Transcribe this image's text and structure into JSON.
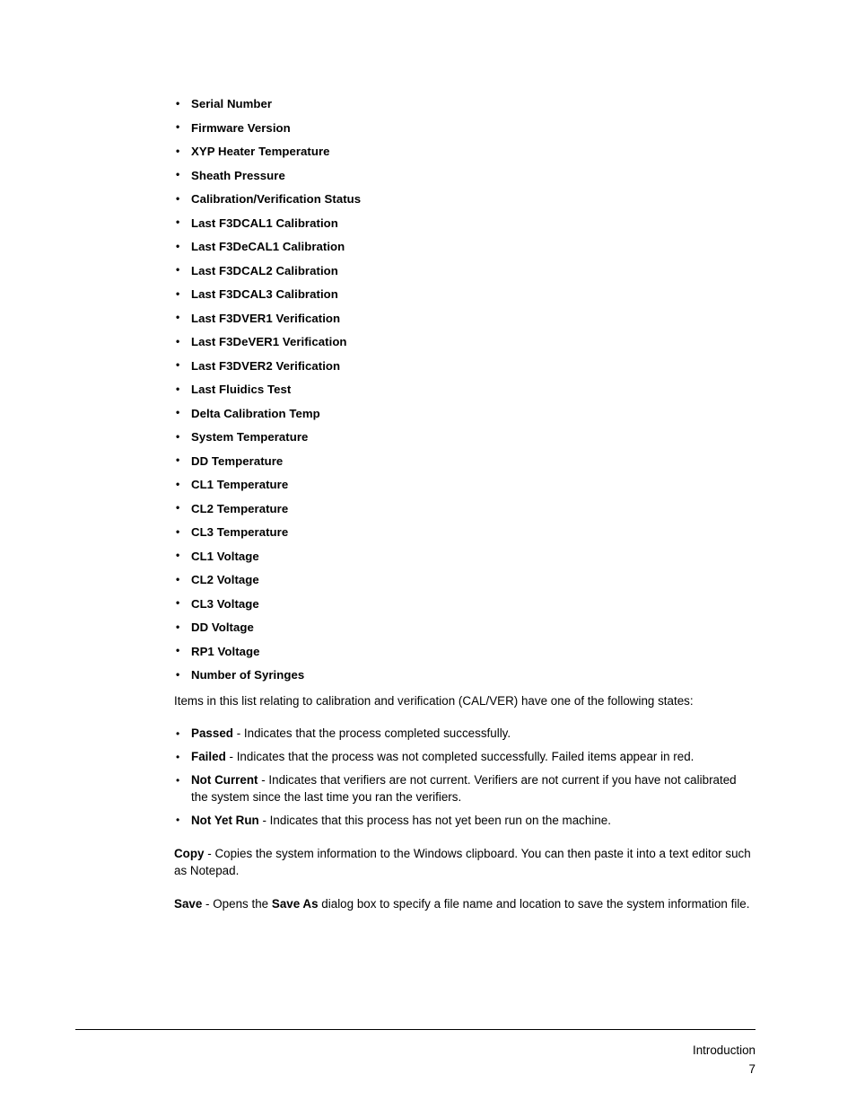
{
  "document": {
    "feature_list": [
      "Serial Number",
      "Firmware Version",
      "XYP Heater Temperature",
      "Sheath Pressure",
      "Calibration/Verification Status",
      "Last F3DCAL1 Calibration",
      "Last F3DeCAL1 Calibration",
      "Last F3DCAL2 Calibration",
      "Last F3DCAL3 Calibration",
      "Last F3DVER1 Verification",
      "Last F3DeVER1 Verification",
      "Last F3DVER2 Verification",
      "Last Fluidics Test",
      "Delta Calibration Temp",
      "System Temperature",
      "DD Temperature",
      "CL1 Temperature",
      "CL2 Temperature",
      "CL3 Temperature",
      "CL1 Voltage",
      "CL2 Voltage",
      "CL3 Voltage",
      "DD Voltage",
      "RP1 Voltage",
      "Number of Syringes"
    ],
    "intro_paragraph": "Items in this list relating to calibration and verification (CAL/VER) have one of the following states:",
    "state_list": [
      {
        "term": "Passed",
        "description": " - Indicates that the process completed successfully."
      },
      {
        "term": "Failed",
        "description": " - Indicates that the process was not completed successfully. Failed items appear in red."
      },
      {
        "term": "Not Current",
        "description": " - Indicates that verifiers are not current. Verifiers are not current if you have not calibrated the system since the last time you ran the verifiers."
      },
      {
        "term": "Not Yet Run",
        "description": " - Indicates that this process has not yet been run on the machine."
      }
    ],
    "copy_paragraph": {
      "term": "Copy",
      "text": " - Copies the system information to the Windows clipboard. You can then paste it into a text editor such as Notepad."
    },
    "save_paragraph": {
      "term": "Save",
      "text_before": " - Opens the ",
      "emphasis": "Save As",
      "text_after": " dialog box to specify a file name and location to save the system information file."
    }
  },
  "footer": {
    "section": "Introduction",
    "page_number": "7"
  }
}
